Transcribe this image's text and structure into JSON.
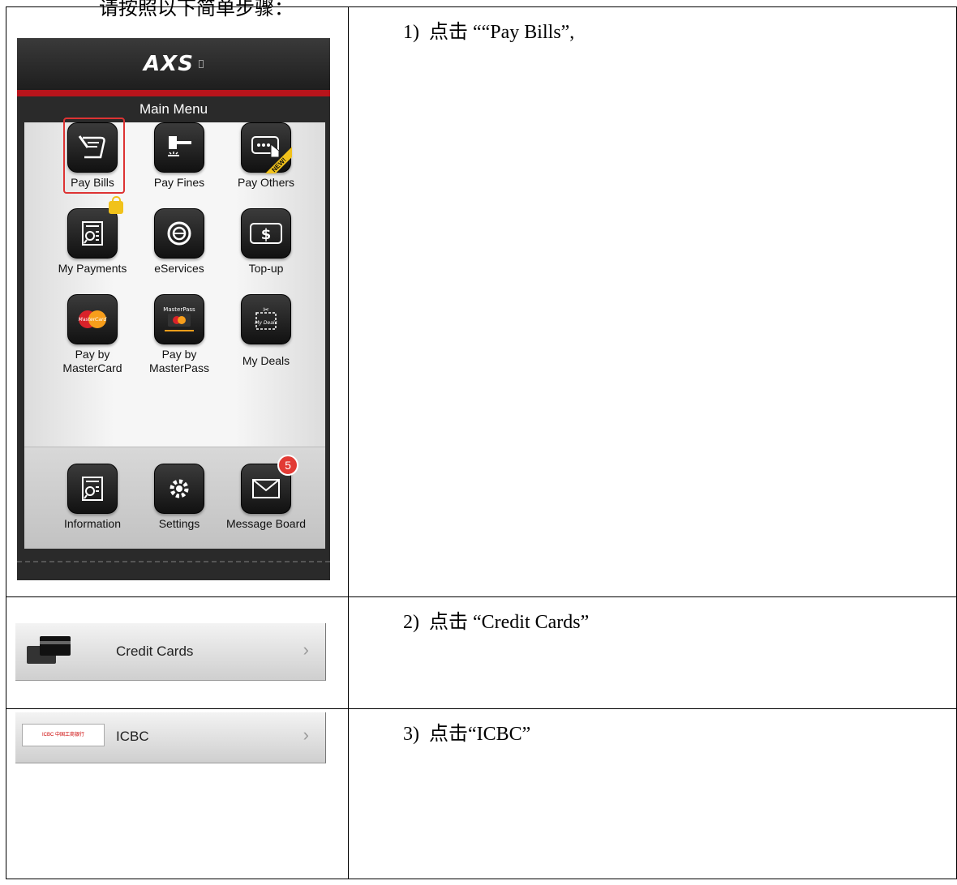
{
  "top_text": "请按照以下简单步骤：",
  "steps": [
    {
      "number": "1)",
      "text": "点击 ““Pay Bills”,"
    },
    {
      "number": "2)",
      "text": "点击 “Credit Cards”"
    },
    {
      "number": "3)",
      "text": "点击“ICBC”"
    }
  ],
  "app": {
    "logo": "AXS",
    "menu_title": "Main Menu",
    "grid": [
      {
        "label": "Pay Bills",
        "icon": "pay-bills-icon",
        "selected": true
      },
      {
        "label": "Pay Fines",
        "icon": "gavel-icon"
      },
      {
        "label": "Pay Others",
        "icon": "pointer-hand-icon",
        "flag": "NEW!"
      },
      {
        "label": "My Payments",
        "icon": "document-search-icon",
        "locked": true
      },
      {
        "label": "eServices",
        "icon": "e-circle-icon"
      },
      {
        "label": "Top-up",
        "icon": "dollar-card-icon"
      },
      {
        "label": "Pay by\nMasterCard",
        "icon": "mastercard-icon",
        "tile_text": "MasterCard"
      },
      {
        "label": "Pay by\nMasterPass",
        "icon": "masterpass-icon",
        "tile_text": "MasterPass"
      },
      {
        "label": "My Deals",
        "icon": "coupon-icon",
        "tile_text": "My Deals"
      }
    ],
    "bottom": [
      {
        "label": "Information",
        "icon": "document-search-icon"
      },
      {
        "label": "Settings",
        "icon": "gear-icon"
      },
      {
        "label": "Message Board",
        "icon": "envelope-icon",
        "badge": "5"
      }
    ]
  },
  "rows": [
    {
      "label": "Credit Cards",
      "icon": "credit-cards-icon"
    },
    {
      "label": "ICBC",
      "icon": "icbc-logo-icon",
      "logo_text": "ICBC 中国工商银行"
    }
  ],
  "colors": {
    "accent_red": "#b8141b",
    "badge_red": "#e23b35",
    "new_yellow": "#f1c21b"
  }
}
